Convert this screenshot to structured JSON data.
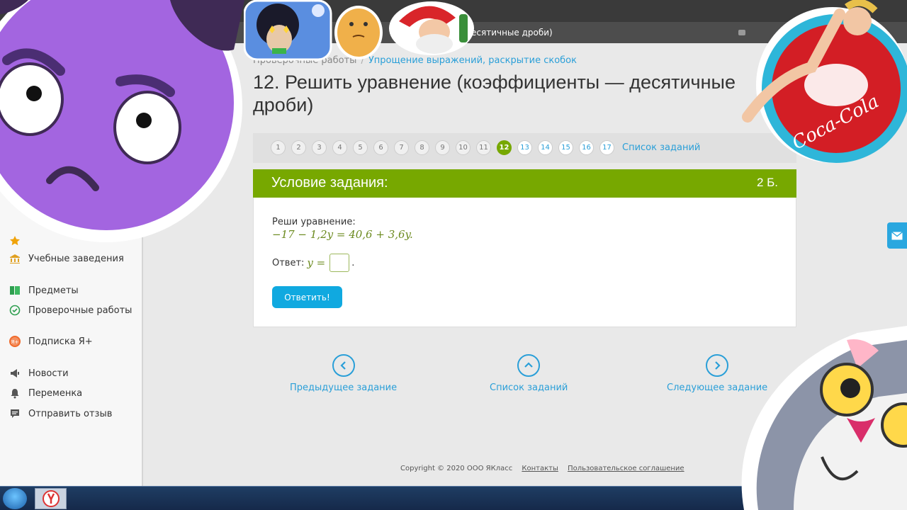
{
  "browser": {
    "tab_title": "есятичные дроби)"
  },
  "breadcrumb": {
    "items": [
      "Проверочные работы",
      "Упрощение выражений, раскрытие скобок"
    ]
  },
  "page_title": "12. Решить уравнение (коэффициенты — десятичные дроби)",
  "pager": {
    "pages": [
      "1",
      "2",
      "3",
      "4",
      "5",
      "6",
      "7",
      "8",
      "9",
      "10",
      "11",
      "12",
      "13",
      "14",
      "15",
      "16",
      "17"
    ],
    "active_index": 11,
    "task_list_label": "Список заданий"
  },
  "task": {
    "header_label": "Условие задания:",
    "points": "2 Б.",
    "prompt": "Реши уравнение:",
    "equation": "−17 − 1,2y = 40,6 + 3,6y.",
    "answer_label": "Ответ:",
    "answer_var": "y =",
    "answer_value": "",
    "answer_dot": ".",
    "submit_label": "Ответить!"
  },
  "sidebar": {
    "items": [
      {
        "label": "Учебные заведения",
        "icon": "building-icon"
      },
      {
        "label": "Предметы",
        "icon": "books-icon"
      },
      {
        "label": "Проверочные работы",
        "icon": "check-circle-icon"
      },
      {
        "label": "Подписка Я+",
        "icon": "plus-badge-icon"
      },
      {
        "label": "Новости",
        "icon": "megaphone-icon"
      },
      {
        "label": "Переменка",
        "icon": "bell-icon"
      },
      {
        "label": "Отправить отзыв",
        "icon": "comment-icon"
      }
    ]
  },
  "navigation": {
    "prev_label": "Предыдущее задание",
    "list_label": "Список заданий",
    "next_label": "Следующее задание"
  },
  "footer": {
    "copyright": "Copyright © 2020 ООО ЯКласс",
    "contacts": "Контакты",
    "agreement": "Пользовательское соглашение"
  },
  "stickers": {
    "coke_text": "Coca-Cola"
  },
  "colors": {
    "accent_green": "#77a800",
    "link_blue": "#2a9fd8",
    "button_blue": "#10a9e0"
  }
}
